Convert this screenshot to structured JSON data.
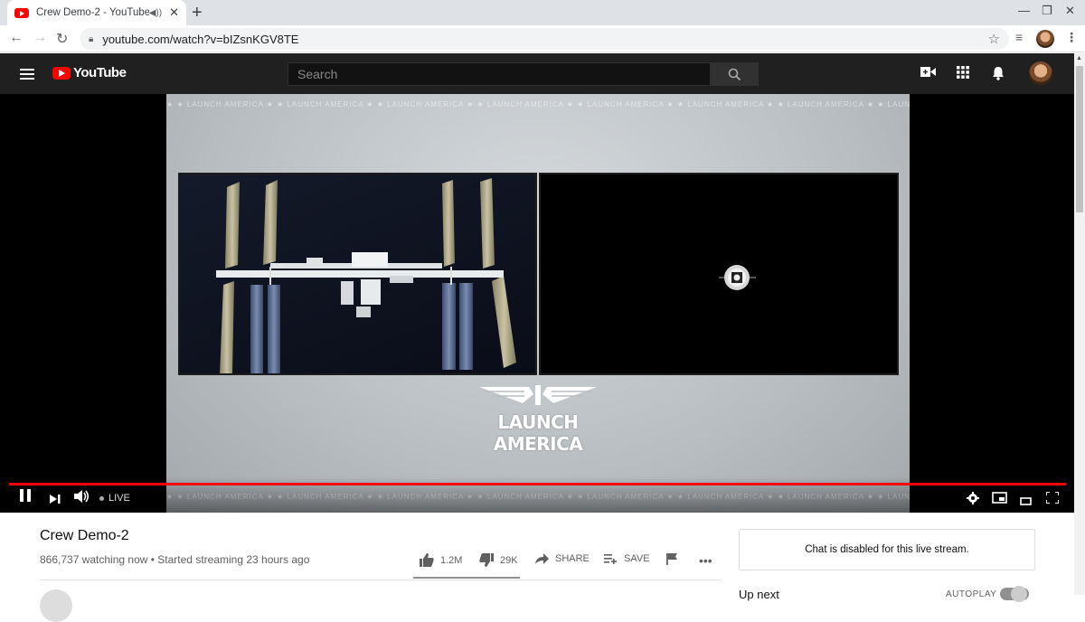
{
  "browser": {
    "tab_title": "Crew Demo-2 - YouTube",
    "url": "youtube.com/watch?v=bIZsnKGV8TE",
    "icons": [
      "back-icon",
      "forward-icon",
      "reload-icon",
      "lock-icon",
      "bookmark-star-icon",
      "media-control-icon",
      "profile-avatar",
      "menu-kebab-icon"
    ]
  },
  "youtube": {
    "logo_text": "YouTube",
    "search_placeholder": "Search",
    "header_icons": [
      "create-video-icon",
      "apps-grid-icon",
      "notifications-bell-icon"
    ]
  },
  "video_overlay": {
    "banner_text": "★ ★ LAUNCH AMERICA ★ ★ LAUNCH AMERICA ★ ★ LAUNCH AMERICA ★ ★ LAUNCH AMERICA ★ ★ LAUNCH AMERICA ★ ★ LAUNCH AMERICA ★ ★ LAUNCH AMERICA ★ ★ LAUNCH AMERICA",
    "logo_text": "LAUNCH AMERICA"
  },
  "player": {
    "live_label": "LIVE",
    "progress": 1.0
  },
  "video": {
    "title": "Crew Demo-2",
    "meta": "866,737 watching now • Started streaming 23 hours ago",
    "likes": "1.2M",
    "dislikes": "29K",
    "share_label": "SHARE",
    "save_label": "SAVE"
  },
  "sidebar": {
    "chat_message": "Chat is disabled for this live stream.",
    "up_next_label": "Up next",
    "autoplay_label": "AUTOPLAY"
  },
  "colors": {
    "yt_red": "#ff0000",
    "header_bg": "#202020",
    "progress": "#ff0000"
  }
}
